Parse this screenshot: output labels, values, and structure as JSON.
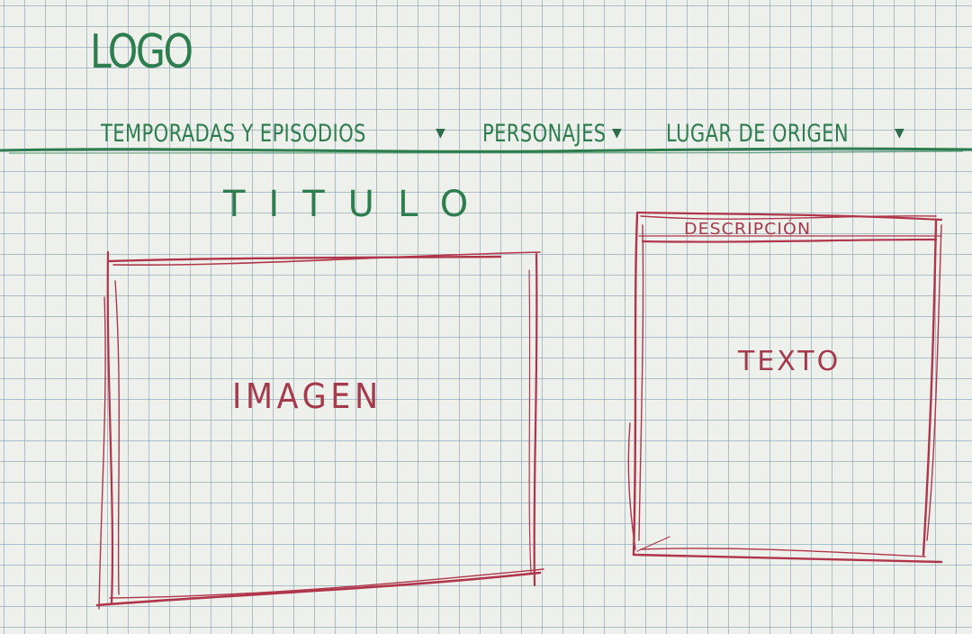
{
  "header": {
    "logo": "LOGO"
  },
  "nav": {
    "items": [
      {
        "label": "TEMPORADAS Y EPISODIOS",
        "icon": "caret-down-icon"
      },
      {
        "label": "PERSONAJES",
        "icon": "caret-down-icon"
      },
      {
        "label": "LUGAR DE ORIGEN",
        "icon": "caret-down-icon"
      }
    ]
  },
  "main": {
    "title": "TITULO",
    "image_label": "IMAGEN",
    "description": {
      "header": "DESCRIPCIÓN",
      "text": "TEXTO"
    }
  },
  "colors": {
    "ink_green": "#2e7d4f",
    "ink_red": "#a53a4c",
    "paper": "#eef0ec",
    "grid": "#7896aa"
  }
}
